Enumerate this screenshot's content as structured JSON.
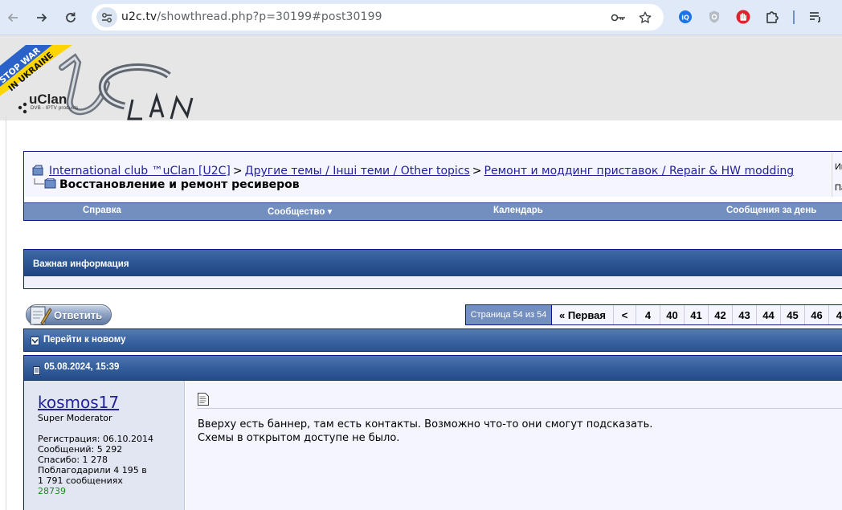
{
  "browser": {
    "url_host": "u2c.tv",
    "url_path": "/showthread.php?p=30199#post30199",
    "icons": [
      "back-arrow",
      "forward-arrow",
      "reload",
      "tune",
      "key",
      "star",
      "extension-q",
      "extension-shield",
      "extension-hand",
      "puzzle",
      "reading-list"
    ]
  },
  "header": {
    "ribbon_line1": "STOP WAR",
    "ribbon_line2": "IN UKRAINE",
    "logo_text": "uClan",
    "logo_sub": "DVB - IPTV products",
    "colors": {
      "ribbon_blue": "#2a62c9",
      "ribbon_yellow": "#ffd500"
    }
  },
  "breadcrumbs": {
    "items": [
      "International club ™uClan [U2C]",
      "Другие темы / Інші теми / Other topics",
      "Ремонт и моддинг приставок / Repair & HW modding"
    ],
    "separator": ">",
    "current": "Восстановление и ремонт ресиверов",
    "side_1": "Им",
    "side_2": "Па"
  },
  "menu": {
    "help": "Справка",
    "community": "Сообщество",
    "calendar": "Календарь",
    "today_posts": "Сообщения за день"
  },
  "info": {
    "title": "Важная информация"
  },
  "reply": {
    "label": "Ответить"
  },
  "pagination": {
    "label": "Страница 54 из 54",
    "first": "« Первая",
    "prev": "<",
    "pages": [
      "4",
      "40",
      "41",
      "42",
      "43",
      "44",
      "45",
      "46",
      "4"
    ]
  },
  "thread": {
    "go_new": "Перейти к новому"
  },
  "post": {
    "date": "05.08.2024, 15:39",
    "username": "kosmos17",
    "role": "Super Moderator",
    "stats": [
      "Регистрация: 06.10.2014",
      "Сообщений: 5 292",
      "Спасибо: 1 278",
      "Поблагодарили 4 195 в",
      "1 791 сообщениях"
    ],
    "reputation": "28739",
    "message_lines": [
      "Вверху есть баннер, там есть контакты. Возможно что-то они смогут подсказать.",
      "Схемы в открытом доступе не было."
    ]
  }
}
